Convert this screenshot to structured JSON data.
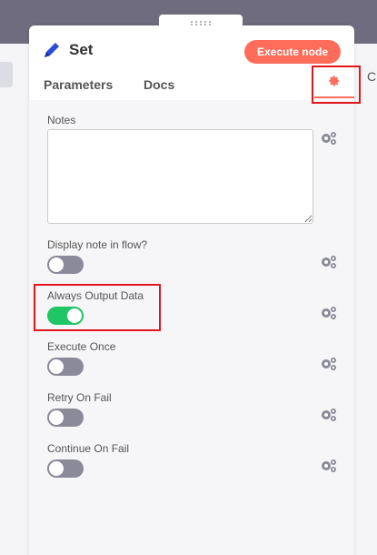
{
  "node": {
    "title": "Set"
  },
  "header": {
    "execute_label": "Execute node"
  },
  "tabs": [
    {
      "label": "Parameters"
    },
    {
      "label": "Docs"
    }
  ],
  "background": {
    "right_letter": "C"
  },
  "settings": {
    "notes_label": "Notes",
    "notes_value": "",
    "display_note_label": "Display note in flow?",
    "always_output_label": "Always Output Data",
    "execute_once_label": "Execute Once",
    "retry_label": "Retry On Fail",
    "continue_label": "Continue On Fail",
    "toggles": {
      "display_note": false,
      "always_output": true,
      "execute_once": false,
      "retry": false,
      "continue": false
    }
  },
  "colors": {
    "accent": "#ff6d5a",
    "toggle_on": "#20c565",
    "toggle_off": "#8a8a99",
    "highlight": "#e0161c"
  }
}
